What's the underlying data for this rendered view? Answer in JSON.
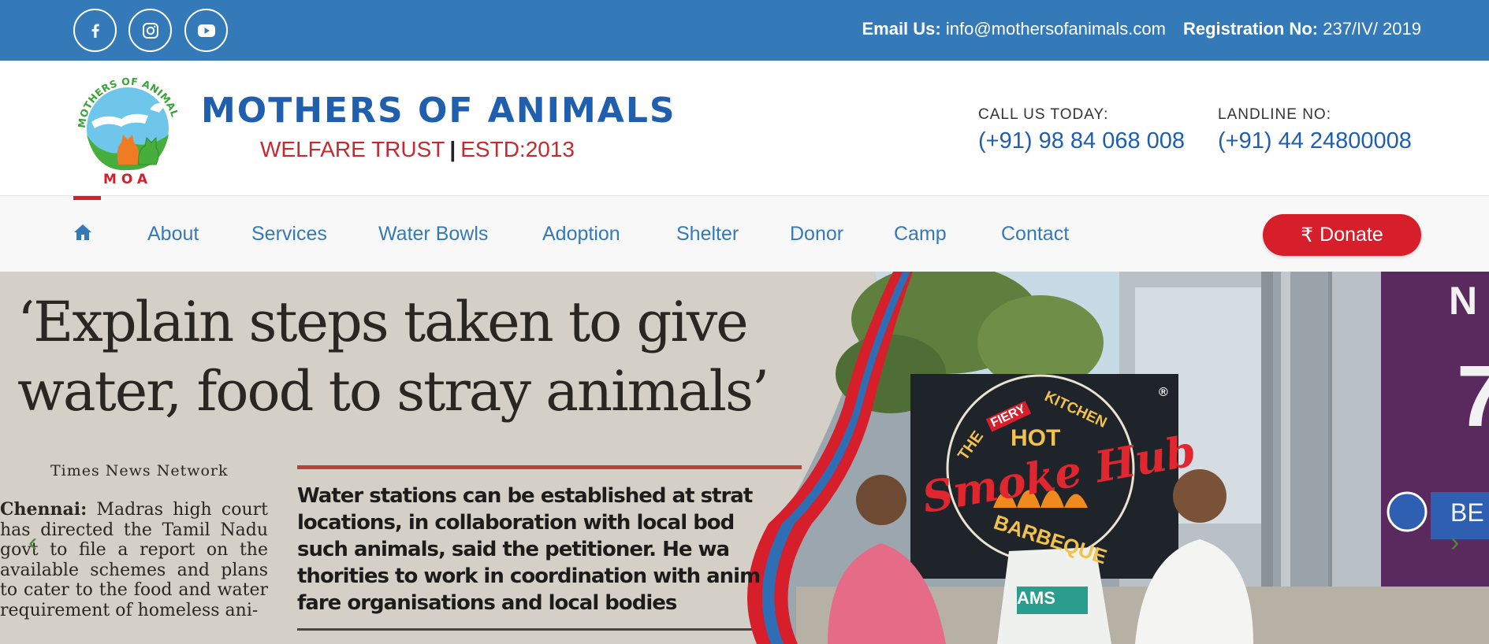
{
  "topbar": {
    "email_label": "Email Us:",
    "email_value": "info@mothersofanimals.com",
    "registration_label": "Registration No:",
    "registration_value": "237/IV/ 2019",
    "social_icons": [
      "facebook-icon",
      "instagram-icon",
      "youtube-icon"
    ]
  },
  "header": {
    "logo_arc_text": "MOTHERS OF ANIMALS",
    "logo_initials": "MOA",
    "title": "MOTHERS OF ANIMALS",
    "subtitle_left": "WELFARE TRUST",
    "subtitle_sep": "|",
    "subtitle_right": "ESTD:2013",
    "call_label": "CALL US TODAY:",
    "call_number": "(+91) 98 84 068 008",
    "landline_label": "LANDLINE NO:",
    "landline_number": "(+91) 44 24800008"
  },
  "nav": {
    "home_icon": "home-icon",
    "items": [
      "About",
      "Services",
      "Water Bowls",
      "Adoption",
      "Shelter",
      "Donor",
      "Camp",
      "Contact"
    ],
    "donate_symbol": "₹",
    "donate_label": "Donate"
  },
  "hero": {
    "headline_line1": "‘Explain steps taken to give",
    "headline_line2": "water, food to stray animals’",
    "byline": "Times News Network",
    "body_lead": "Chennai:",
    "body_text": " Madras high court has directed the Tamil Nadu govt to file a report on the available schemes and plans to cater to the food and water requirement of homeless ani-",
    "pull_quote": "Water stations can be established at strat locations, in collaboration with local bod such animals, said the petitioner. He wa thorities to work in coordination with anim fare organisations and local bodies",
    "sign_the": "THE",
    "sign_fiery": "FIERY",
    "sign_kitchen": "KITCHEN",
    "sign_hot": "HOT",
    "sign_brand": "Smoke Hub",
    "sign_barbeque": "BARBEQUE",
    "sign_registered": "®",
    "bag_text": "AMS",
    "banner_top": "N",
    "banner_num": "7",
    "banner_side": "BE",
    "arrow_prev": "‹",
    "arrow_next": "›"
  },
  "colors": {
    "topbar_blue": "#357ab8",
    "brand_blue": "#1f5fae",
    "brand_red": "#c42a2f",
    "donate_red": "#d61f2b",
    "nav_link": "#357ab8"
  }
}
